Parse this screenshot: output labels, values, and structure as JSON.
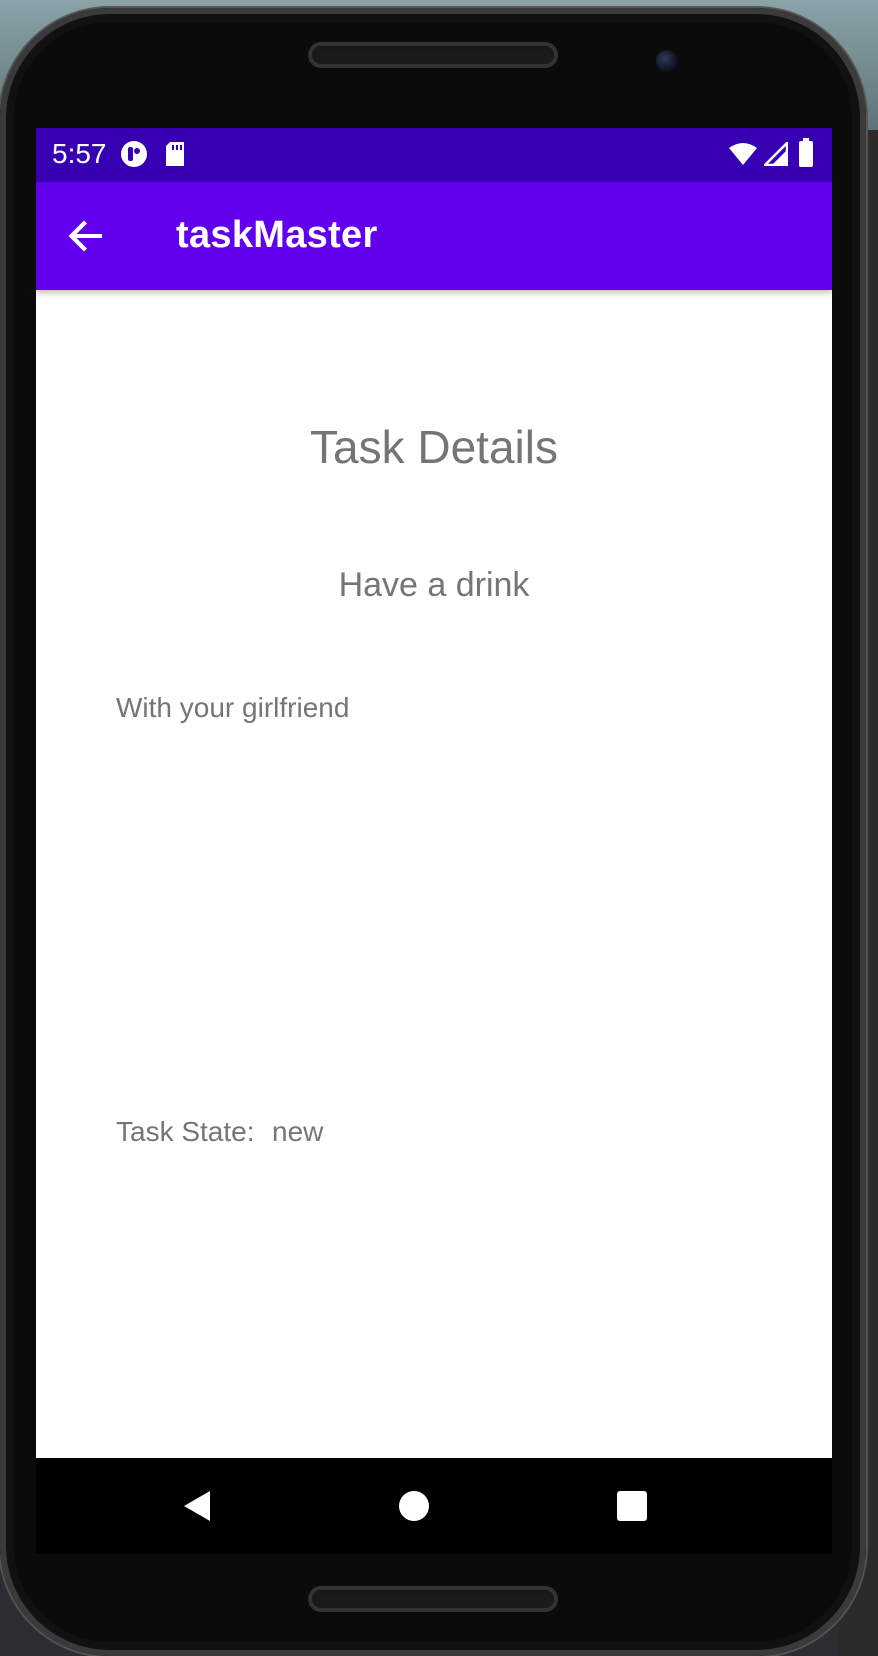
{
  "status_bar": {
    "time": "5:57",
    "left_icons": [
      "notification-app-icon",
      "sd-card-icon"
    ],
    "right_icons": [
      "wifi-icon",
      "signal-icon",
      "battery-icon"
    ],
    "color": "#3700b3"
  },
  "app_bar": {
    "title": "taskMaster",
    "back_icon": "arrow-back-icon",
    "color": "#6200ee"
  },
  "task_detail": {
    "page_title": "Task Details",
    "task_title": "Have a drink",
    "task_body": "With your girlfriend",
    "state_label": "Task State:",
    "state_value": "new"
  },
  "nav_bar": {
    "buttons": [
      "back-triangle-icon",
      "home-circle-icon",
      "recents-square-icon"
    ]
  }
}
